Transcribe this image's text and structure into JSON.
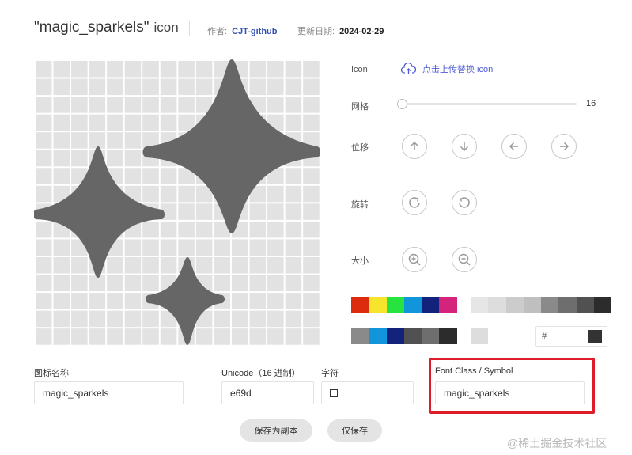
{
  "header": {
    "title": "\"magic_sparkels\"",
    "title_suffix": "icon",
    "author_label": "作者:",
    "author": "CJT-github",
    "date_label": "更新日期:",
    "date": "2024-02-29"
  },
  "editor": {
    "icon_label": "Icon",
    "upload_label": "点击上传替换 icon",
    "grid_label": "网格",
    "grid_value": "16",
    "grid_fraction": 0.0,
    "move_label": "位移",
    "rotate_label": "旋转",
    "size_label": "大小",
    "icons": {
      "upload": "cloud-upload-icon",
      "move": [
        "arrow-up-icon",
        "arrow-down-icon",
        "arrow-left-icon",
        "arrow-right-icon"
      ],
      "rotate": [
        "rotate-clockwise-icon",
        "rotate-counterclockwise-icon"
      ],
      "size": [
        "zoom-in-icon",
        "zoom-out-icon"
      ]
    },
    "palette_colors": [
      "#dd2b0e",
      "#f5e52c",
      "#27e33f",
      "#1296db",
      "#13227a",
      "#d4237a"
    ],
    "gray_colors": [
      "#e6e6e6",
      "#dddddd",
      "#cccccc",
      "#bfbfbf",
      "#8a8a8a",
      "#6e6e6e",
      "#515151",
      "#2c2c2c"
    ],
    "recent_colors": [
      "#8a8a8a",
      "#1296db",
      "#13227a",
      "#515151",
      "#6e6e6e",
      "#2c2c2c"
    ],
    "single_color": "#dddddd",
    "hex_prefix": "#",
    "current_color": "#333333",
    "icon_fill": "#666666"
  },
  "fields": {
    "name_label": "图标名称",
    "name_value": "magic_sparkels",
    "unicode_label": "Unicode（16 进制）",
    "unicode_value": "e69d",
    "char_label": "字符",
    "fontclass_label": "Font Class / Symbol",
    "fontclass_value": "magic_sparkels"
  },
  "actions": {
    "save_copy": "保存为副本",
    "save_only": "仅保存"
  },
  "watermark": "@稀土掘金技术社区"
}
